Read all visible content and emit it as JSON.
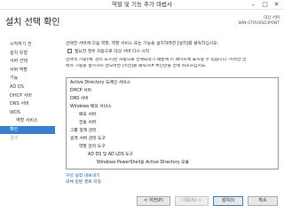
{
  "window": {
    "title": "역할 및 기능 추가 마법사",
    "minimize": "–",
    "maximize": "□",
    "close": "✕"
  },
  "page": {
    "heading": "설치 선택 확인",
    "destination_label": "대상 서버",
    "destination_server": "WIN-STOV8SD3P0NT"
  },
  "nav": {
    "items": [
      {
        "label": "시작하기 전",
        "state": "normal"
      },
      {
        "label": "설치 유형",
        "state": "normal"
      },
      {
        "label": "서버 선택",
        "state": "normal"
      },
      {
        "label": "서버 역할",
        "state": "normal"
      },
      {
        "label": "기능",
        "state": "normal"
      },
      {
        "label": "AD DS",
        "state": "normal"
      },
      {
        "label": "DHCP 서버",
        "state": "normal"
      },
      {
        "label": "DNS 서버",
        "state": "normal"
      },
      {
        "label": "WDS",
        "state": "normal"
      },
      {
        "label": "역할 서비스",
        "state": "sub"
      },
      {
        "label": "확인",
        "state": "current"
      },
      {
        "label": "결과",
        "state": "disabled"
      }
    ]
  },
  "content": {
    "intro": "선택한 서버에 다음 역할, 역할 서비스 또는 기능을 설치하려면 [설치]를 클릭하십시오.",
    "restart_checkbox_label": "필요한 경우 자동으로 대상 서버 다시 시작",
    "note_lines": [
      "선택적 기능(예: 관리 도구)은 자동으로 선택되었기 때문에 이 페이지에 표시될 수 있습니다. 이러한 선",
      "택적 기능을 설치하지 않으려면 [이전]을 클릭하여 확인란을 선택 취소하십시오."
    ],
    "features": [
      {
        "label": "Active Directory 도메인 서비스",
        "level": 0
      },
      {
        "label": "DHCP 서버",
        "level": 0
      },
      {
        "label": "DNS 서버",
        "level": 0
      },
      {
        "label": "Windows 배포 서비스",
        "level": 0
      },
      {
        "label": "배포 서버",
        "level": 1
      },
      {
        "label": "전송 서버",
        "level": 1
      },
      {
        "label": "그룹 정책 관리",
        "level": 0
      },
      {
        "label": "원격 서버 관리 도구",
        "level": 0
      },
      {
        "label": "역할 관리 도구",
        "level": 1
      },
      {
        "label": "AD DS 및 AD LDS 도구",
        "level": 2
      },
      {
        "label": "Windows PowerShell용 Active Directory 모듈",
        "level": 3
      }
    ],
    "export_link": "구성 설정 내보내기",
    "alt_source_link": "대체 원본 경로 지정"
  },
  "buttons": {
    "previous": "< 이전(P)",
    "next": "다음(N) >",
    "install": "설치(I)",
    "cancel": "취소"
  }
}
